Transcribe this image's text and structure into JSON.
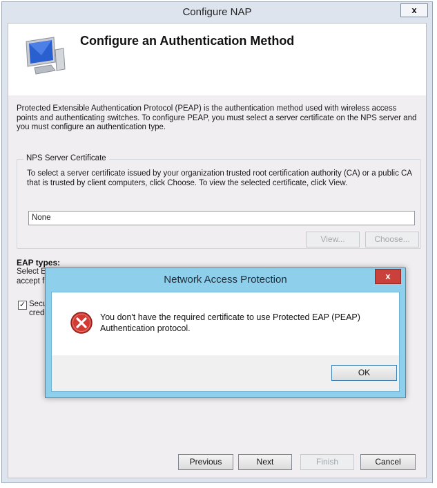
{
  "window": {
    "title": "Configure NAP",
    "close_label": "x"
  },
  "header": {
    "icon": "computer-monitor-icon",
    "title": "Configure an Authentication Method"
  },
  "intro": {
    "text": "Protected Extensible Authentication Protocol (PEAP) is the authentication method used with wireless access points and authenticating switches. To configure PEAP, you must select a server certificate on the NPS server and you must configure an authentication type."
  },
  "certificate_group": {
    "legend": "NPS Server Certificate",
    "description": "To select a server certificate issued by your organization trusted root certification authority (CA) or a public CA that is trusted by client computers, click Choose. To view the selected certificate, click View.",
    "value": "None",
    "view_label": "View...",
    "choose_label": "Choose..."
  },
  "eap": {
    "title": "EAP types:",
    "line1": "Select E",
    "line2": "accept f",
    "checkbox_checked": true,
    "checkbox_line1": "Secu",
    "checkbox_line2": "crede"
  },
  "modal": {
    "title": "Network Access Protection",
    "close_label": "x",
    "icon": "error-icon",
    "message": "You don't have the required certificate to use Protected EAP (PEAP) Authentication protocol.",
    "ok_label": "OK"
  },
  "footer": {
    "previous_label": "Previous",
    "next_label": "Next",
    "finish_label": "Finish",
    "cancel_label": "Cancel"
  },
  "colors": {
    "window_frame": "#dde4ee",
    "modal_frame": "#8ed0ec",
    "error_red": "#c9413a"
  }
}
